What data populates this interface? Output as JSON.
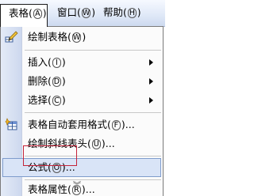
{
  "menubar": {
    "items": [
      {
        "label": "表格",
        "mnemonic": "A",
        "close": ")"
      },
      {
        "label": "窗口",
        "mnemonic": "W",
        "close": ")"
      },
      {
        "label": "帮助",
        "mnemonic": "H",
        "close": ")"
      }
    ]
  },
  "table_menu": {
    "items": [
      {
        "label": "绘制表格",
        "mnemonic": "W",
        "close": ")",
        "suffix": "",
        "icon": "pencil-icon"
      },
      {
        "label": "插入",
        "mnemonic": "I",
        "close": ")",
        "suffix": "",
        "submenu": true
      },
      {
        "label": "删除",
        "mnemonic": "D",
        "close": ")",
        "suffix": "",
        "submenu": true
      },
      {
        "label": "选择",
        "mnemonic": "C",
        "close": ")",
        "suffix": "",
        "submenu": true
      },
      {
        "label": "表格自动套用格式",
        "mnemonic": "F",
        "close": ")",
        "suffix": "...",
        "icon": "autoformat-icon"
      },
      {
        "label": "绘制斜线表头",
        "mnemonic": "U",
        "close": ")",
        "suffix": "..."
      },
      {
        "label": "公式",
        "mnemonic": "O",
        "close": ")",
        "suffix": "...",
        "highlighted": true
      },
      {
        "label": "表格属性",
        "mnemonic": "R",
        "close": ")",
        "suffix": "..."
      }
    ],
    "expand_glyph": "︾"
  },
  "colors": {
    "highlight_fill": "#d9e4f7",
    "highlight_border": "#7f9ccc",
    "annotation_red": "#c4243a"
  }
}
